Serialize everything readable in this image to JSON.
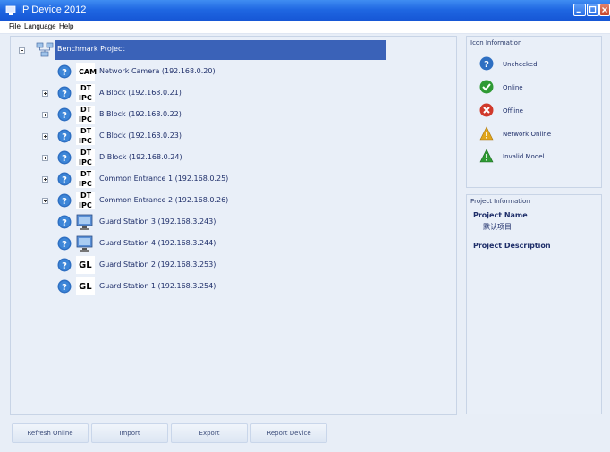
{
  "window": {
    "title": "IP Device 2012"
  },
  "menu": [
    "File",
    "Language",
    "Help"
  ],
  "tree": {
    "root_label": "Benchmark Project",
    "devices": [
      {
        "status": "unchecked",
        "icon": "CAM",
        "label": "Network Camera (192.168.0.20)",
        "expandable": false
      },
      {
        "status": "unchecked",
        "icon": "DT IPC",
        "label": "A Block (192.168.0.21)",
        "expandable": true
      },
      {
        "status": "unchecked",
        "icon": "DT IPC",
        "label": "B Block (192.168.0.22)",
        "expandable": true
      },
      {
        "status": "unchecked",
        "icon": "DT IPC",
        "label": "C Block (192.168.0.23)",
        "expandable": true
      },
      {
        "status": "unchecked",
        "icon": "DT IPC",
        "label": "D Block (192.168.0.24)",
        "expandable": true
      },
      {
        "status": "unchecked",
        "icon": "DT IPC",
        "label": "Common Entrance 1 (192.168.0.25)",
        "expandable": true
      },
      {
        "status": "unchecked",
        "icon": "DT IPC",
        "label": "Common Entrance 2 (192.168.0.26)",
        "expandable": true
      },
      {
        "status": "unchecked",
        "icon": "monitor",
        "label": "Guard Station 3 (192.168.3.243)",
        "expandable": false
      },
      {
        "status": "unchecked",
        "icon": "monitor",
        "label": "Guard Station 4 (192.168.3.244)",
        "expandable": false
      },
      {
        "status": "unchecked",
        "icon": "GL",
        "label": "Guard Station 2 (192.168.3.253)",
        "expandable": false
      },
      {
        "status": "unchecked",
        "icon": "GL",
        "label": "Guard Station 1 (192.168.3.254)",
        "expandable": false
      }
    ]
  },
  "icon_info": {
    "title": "Icon Information",
    "items": [
      {
        "icon": "unchecked-icon",
        "label": "Unchecked",
        "color": "#2e6fc2"
      },
      {
        "icon": "online-icon",
        "label": "Online",
        "color": "#2f9a34"
      },
      {
        "icon": "offline-icon",
        "label": "Offline",
        "color": "#d0392b"
      },
      {
        "icon": "network-online-icon",
        "label": "Network Online",
        "color": "#e0a51c"
      },
      {
        "icon": "invalid-model-icon",
        "label": "Invalid Model",
        "color": "#2f9a34"
      }
    ]
  },
  "project_info": {
    "title": "Project Information",
    "name_label": "Project Name",
    "name_value": "默认项目",
    "description_label": "Project Description"
  },
  "buttons": [
    "Refresh Online",
    "Import",
    "Export",
    "Report Device"
  ],
  "colors": {
    "titlebar": "#1f67e2",
    "selection": "#3a62b8",
    "panel_bg": "#e9eff8"
  }
}
